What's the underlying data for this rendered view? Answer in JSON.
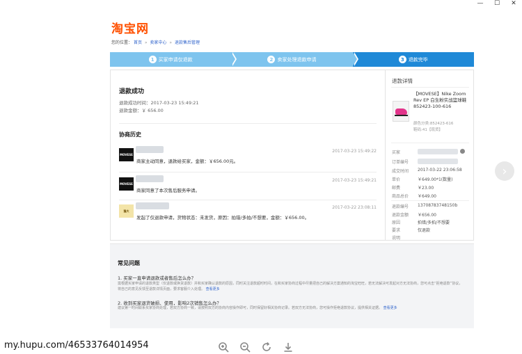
{
  "window": {
    "minimize": "—",
    "maximize": "☐",
    "close": "✕"
  },
  "logo": "淘宝网",
  "breadcrumb": {
    "prefix": "您的位置：",
    "items": [
      "首页",
      "卖家中心",
      "退款售后管理"
    ],
    "sep": "»"
  },
  "steps": [
    {
      "num": "1",
      "label": "买家申请仅退款"
    },
    {
      "num": "2",
      "label": "卖家处理退款申请"
    },
    {
      "num": "3",
      "label": "退款完毕"
    }
  ],
  "refund": {
    "title": "退款成功",
    "time_label": "退款成功时间：2017-03-23 15:49:21",
    "amount_label": "退款金额：￥ 656.00"
  },
  "history": {
    "title": "协商历史",
    "items": [
      {
        "avatar": "MOVESE",
        "role": "seller",
        "time": "2017-03-23 15:49:22",
        "msg": "商家主动同意，退款给买家，金额：￥656.00元。"
      },
      {
        "avatar": "MOVESE",
        "role": "seller",
        "time": "2017-03-23 15:49:21",
        "msg": "商家同意了本次售后服务申请。"
      },
      {
        "avatar": "猫大",
        "role": "buyer",
        "time": "2017-03-22 23:08:11",
        "msg": "发起了仅退款申请，货物状态：未发货，原因：拍错/多拍/不想要，金额：￥656.00。"
      }
    ]
  },
  "detail": {
    "title": "退款详情",
    "product_name": "【MOVESE】Nike Zoom Rev EP 白生粉实战篮球鞋 852423-100-616",
    "attr_color": "颜色分类:852423-616",
    "attr_size": "鞋码:41【现货】",
    "rows": [
      {
        "k": "买家",
        "v": ""
      },
      {
        "k": "订单编号",
        "v": ""
      },
      {
        "k": "成交时间",
        "v": "2017-03-22 23:06:58"
      },
      {
        "k": "单价",
        "v": "￥649.00*1(数量)"
      },
      {
        "k": "邮费",
        "v": "￥23.00"
      },
      {
        "k": "商品总价",
        "v": "￥649.00"
      },
      {
        "k": "退款编号",
        "v": "13708783748150b"
      },
      {
        "k": "退款金额",
        "v": "￥656.00"
      },
      {
        "k": "原因",
        "v": "拍错/多拍/不想要"
      },
      {
        "k": "要求",
        "v": "仅退款"
      },
      {
        "k": "说明",
        "v": ""
      }
    ]
  },
  "faq": {
    "title": "常见问题",
    "q1": "1. 买家一直申请退款或者售后怎么办？",
    "a1": "需根据买家申请的退款类型（仅退款或换货退款）并和买家确认退款的原因，同时关注退款超时时间，在和买家协商过程中尽量把自己的解决方案通知的淘宝旺旺，若无法解决可发起对方无法协商，您可点击“拒绝退款”协议，将自己的意见反馈至退款详情页面，要求客服介入处理。",
    "more1": "查看更多",
    "q2": "2. 收到买家退货破损、使用，影响2次销售怎么办？",
    "a2": "建议第一时间联系买家协商处理，若双方协商一致，请按照双方的协商内容操作即可，同时保留好相关协商记录。若双方无法协商，您可操作拒绝退款协议，提供相关证据。",
    "more2": "查看更多"
  },
  "watermark": "my.hupu.com/46533764014954"
}
